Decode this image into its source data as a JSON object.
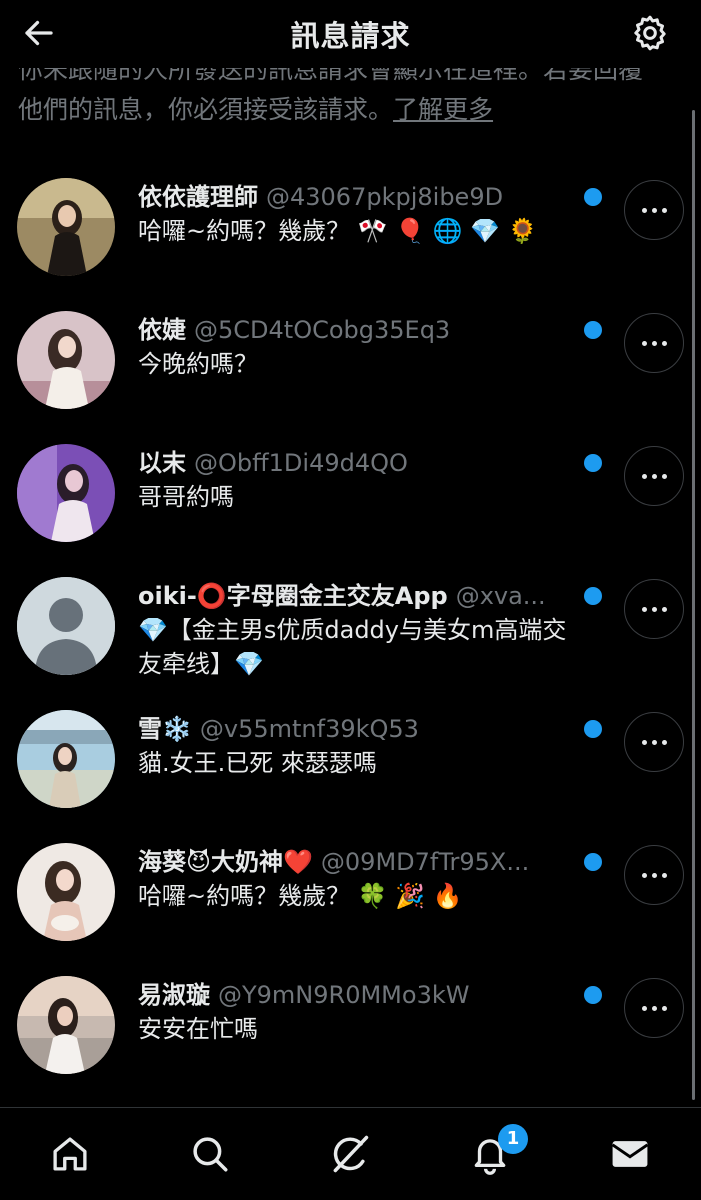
{
  "header": {
    "title": "訊息請求"
  },
  "intro": {
    "line1": "你未跟隨的人所發送的訊息請求會顯示在這裡。若要回覆",
    "line2": "他們的訊息，你必須接受該請求。",
    "link": "了解更多"
  },
  "requests": [
    {
      "name": "依依護理師",
      "handle": "@43067pkpj8ibe9D",
      "message": "哈囉~約嗎？幾歲？ 🎌 🎈 🌐 💎 🌻",
      "unread": true
    },
    {
      "name": "依婕",
      "handle": "@5CD4tOCobg35Eq3",
      "message": "今晚約嗎？",
      "unread": true
    },
    {
      "name": "以末",
      "handle": "@Obff1Di49d4QO",
      "message": "哥哥約嗎",
      "unread": true
    },
    {
      "name": "oiki-⭕字母圈金主交友App",
      "handle": "@xva...",
      "message": "💎【金主男s优质daddy与美女m高端交友牵线】💎",
      "unread": true
    },
    {
      "name": "雪❄️",
      "handle": "@v55mtnf39kQ53",
      "message": "貓.女王.已死 來瑟瑟嗎",
      "unread": true
    },
    {
      "name": "海葵😈大奶神❤️",
      "handle": "@09MD7fTr95X...",
      "message": "哈囉~約嗎？幾歲？ 🍀 🎉 🔥",
      "unread": true
    },
    {
      "name": "易淑璇",
      "handle": "@Y9mN9R0MMo3kW",
      "message": "安安在忙嗎",
      "unread": true
    }
  ],
  "bottom_nav": {
    "items": [
      "home-icon",
      "search-icon",
      "grok-icon",
      "notifications-icon",
      "messages-icon"
    ],
    "notification_badge": "1"
  },
  "colors": {
    "accent": "#1d9bf0",
    "background": "#000000",
    "muted": "#71767b"
  }
}
